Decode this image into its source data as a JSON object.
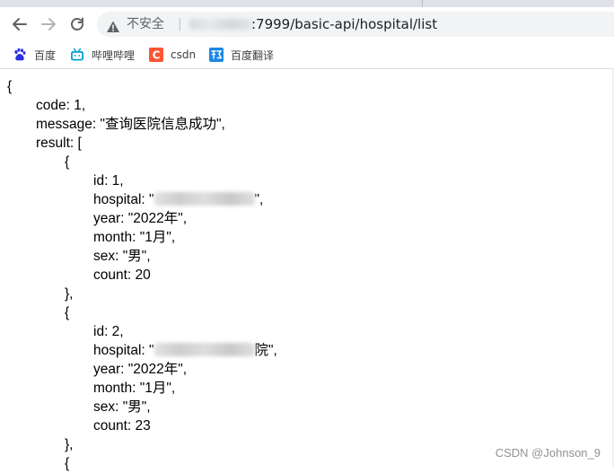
{
  "browser": {
    "nav": [
      "back-arrow-icon",
      "forward-arrow-icon",
      "reload-icon"
    ],
    "security_label": "不安全",
    "security_separator": "|",
    "url_visible": ":7999/basic-api/hospital/list"
  },
  "bookmarks": [
    {
      "label": "百度",
      "icon": "baidu-paw-icon"
    },
    {
      "label": "哔哩哔哩",
      "icon": "bilibili-tv-icon"
    },
    {
      "label": "csdn",
      "icon": "csdn-c-icon"
    },
    {
      "label": "百度翻译",
      "icon": "translate-icon"
    }
  ],
  "json": {
    "open_brace": "{",
    "code": "code: 1,",
    "message": "message: \"查询医院信息成功\",",
    "result": "result: [",
    "record_open": "{",
    "record_close": "},",
    "hospital_prefix": "hospital: \"",
    "hospital_suffix_1": "\",",
    "hospital_suffix_2": "院\",",
    "records": [
      {
        "id": "id: 1,",
        "year": "year: \"2022年\",",
        "month": "month: \"1月\",",
        "sex": "sex: \"男\",",
        "count": "count: 20"
      },
      {
        "id": "id: 2,",
        "year": "year: \"2022年\",",
        "month": "month: \"1月\",",
        "sex": "sex: \"男\",",
        "count": "count: 23"
      }
    ]
  },
  "watermark": "CSDN @Johnson_9"
}
